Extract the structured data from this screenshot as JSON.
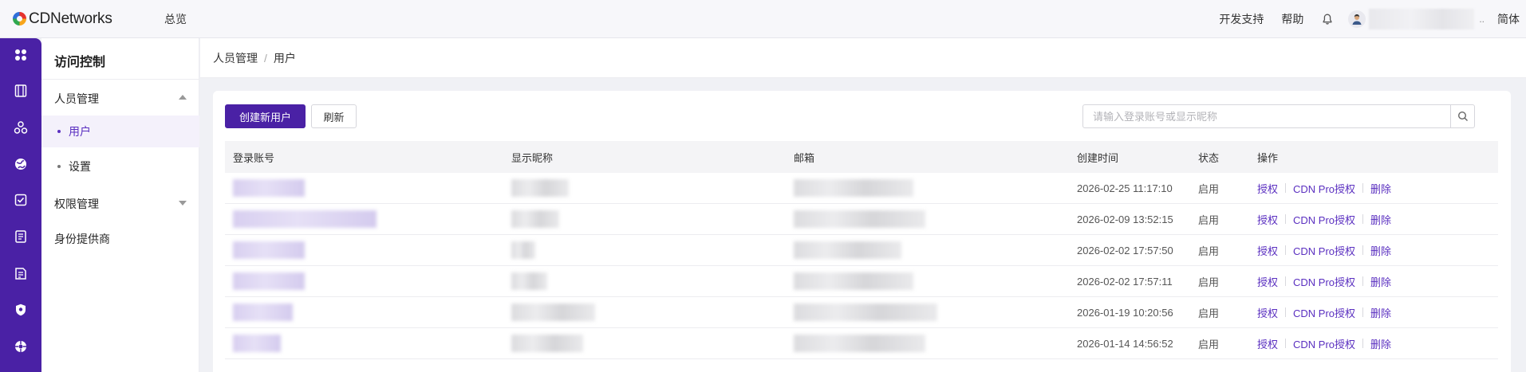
{
  "header": {
    "brand": "CDNetworks",
    "nav_overview": "总览",
    "dev_support": "开发支持",
    "help": "帮助",
    "language": "简体",
    "ellipsis": ".."
  },
  "rail": {
    "icons": [
      "apps-icon",
      "product-icon",
      "network-icon",
      "globe-icon",
      "checklist-icon",
      "document-icon",
      "report-icon",
      "shield-icon",
      "support-icon"
    ],
    "color": "#4a21a5"
  },
  "sidebar": {
    "title": "访问控制",
    "groups": [
      {
        "label": "人员管理",
        "expanded": true,
        "items": [
          {
            "label": "用户",
            "active": true
          },
          {
            "label": "设置",
            "active": false
          }
        ]
      },
      {
        "label": "权限管理",
        "expanded": false
      },
      {
        "label": "身份提供商"
      }
    ]
  },
  "breadcrumb": {
    "items": [
      "人员管理",
      "用户"
    ],
    "separator": "/"
  },
  "toolbar": {
    "create_label": "创建新用户",
    "refresh_label": "刷新",
    "search_placeholder": "请输入登录账号或显示昵称"
  },
  "table": {
    "columns": [
      "登录账号",
      "显示昵称",
      "邮箱",
      "创建时间",
      "状态",
      "操作"
    ],
    "rows": [
      {
        "created": "2026-02-25 11:17:10",
        "status": "启用"
      },
      {
        "created": "2026-02-09 13:52:15",
        "status": "启用"
      },
      {
        "created": "2026-02-02 17:57:50",
        "status": "启用"
      },
      {
        "created": "2026-02-02 17:57:11",
        "status": "启用"
      },
      {
        "created": "2026-01-19 10:20:56",
        "status": "启用"
      },
      {
        "created": "2026-01-14 14:56:52",
        "status": "启用"
      }
    ],
    "actions": {
      "authorize": "授权",
      "cdn_pro_authorize": "CDN Pro授权",
      "delete": "删除"
    }
  },
  "colors": {
    "accent": "#4a21a5",
    "link": "#5a2fc0"
  }
}
